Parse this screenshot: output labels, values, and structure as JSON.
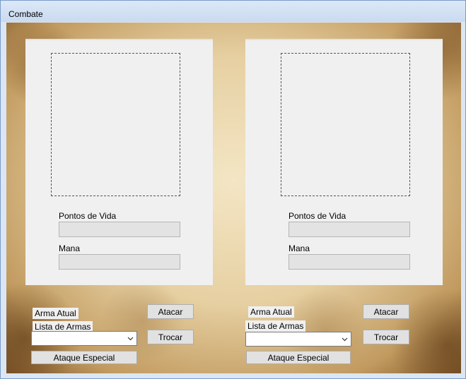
{
  "window": {
    "title": "Combate"
  },
  "players": [
    {
      "hp_label": "Pontos de Vida",
      "mana_label": "Mana",
      "current_weapon_label": "Arma Atual",
      "weapons_list_label": "Lista de Armas",
      "attack_button": "Atacar",
      "swap_button": "Trocar",
      "special_attack_button": "Ataque Especial"
    },
    {
      "hp_label": "Pontos de Vida",
      "mana_label": "Mana",
      "current_weapon_label": "Arma Atual",
      "weapons_list_label": "Lista de Armas",
      "attack_button": "Atacar",
      "swap_button": "Trocar",
      "special_attack_button": "Ataque Especial"
    }
  ],
  "icons": {
    "dropdown": "chevron-down-icon"
  }
}
